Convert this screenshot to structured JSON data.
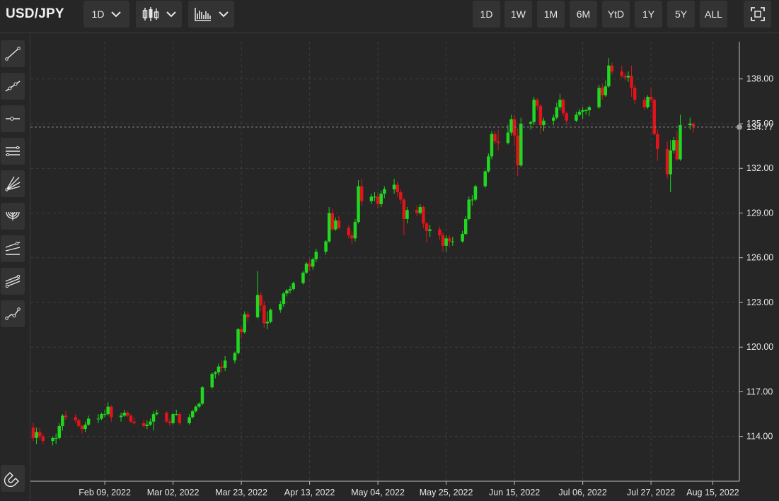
{
  "header": {
    "symbol": "USD/JPY",
    "interval_label": "1D",
    "chart_type_icon": "candlestick-icon",
    "indicator_icon": "bar-chart-icon",
    "ranges": [
      "1D",
      "1W",
      "1M",
      "6M",
      "YtD",
      "1Y",
      "5Y",
      "ALL"
    ],
    "fullscreen_icon": "fullscreen-icon"
  },
  "sidebar": {
    "tools": [
      "trend-line-icon",
      "extended-line-icon",
      "horizontal-ray-icon",
      "parallel-channel-icon",
      "fan-lines-icon",
      "arc-icon",
      "pitchfork-icon",
      "fibonacci-icon",
      "polyline-icon"
    ],
    "magnet_icon": "magnet-icon"
  },
  "colors": {
    "up": "#1fd81f",
    "down": "#e1141b",
    "background": "#262626",
    "grid": "#3d3d3d",
    "last_price_line": "#8c8c8c"
  },
  "chart_data": {
    "type": "candlestick",
    "title": "",
    "xlabel": "",
    "ylabel": "",
    "ylim": [
      111,
      140.5
    ],
    "y_ticks": [
      "114.00",
      "117.00",
      "120.00",
      "123.00",
      "126.00",
      "129.00",
      "132.00",
      "135.00",
      "138.00"
    ],
    "x_ticks": [
      {
        "date": "2022-02-09",
        "label": "Feb 09, 2022"
      },
      {
        "date": "2022-03-02",
        "label": "Mar 02, 2022"
      },
      {
        "date": "2022-03-23",
        "label": "Mar 23, 2022"
      },
      {
        "date": "2022-04-13",
        "label": "Apr 13, 2022"
      },
      {
        "date": "2022-05-04",
        "label": "May 04, 2022"
      },
      {
        "date": "2022-05-25",
        "label": "May 25, 2022"
      },
      {
        "date": "2022-06-15",
        "label": "Jun 15, 2022"
      },
      {
        "date": "2022-07-06",
        "label": "Jul 06, 2022"
      },
      {
        "date": "2022-07-27",
        "label": "Jul 27, 2022"
      },
      {
        "date": "2022-08-15",
        "label": "Aug 15, 2022"
      }
    ],
    "x_range": [
      "2022-01-18",
      "2022-08-21"
    ],
    "last_price": "134.77",
    "grid": true,
    "candles": [
      [
        "2022-01-18",
        114.6,
        114.9,
        113.7,
        113.9
      ],
      [
        "2022-01-19",
        113.9,
        114.6,
        113.5,
        114.3
      ],
      [
        "2022-01-20",
        114.3,
        114.6,
        113.8,
        114.0
      ],
      [
        "2022-01-21",
        114.0,
        114.2,
        113.5,
        113.7
      ],
      [
        "2022-01-24",
        113.7,
        114.0,
        113.4,
        113.9
      ],
      [
        "2022-01-25",
        113.9,
        114.2,
        113.5,
        113.9
      ],
      [
        "2022-01-26",
        113.9,
        114.9,
        113.8,
        114.7
      ],
      [
        "2022-01-27",
        114.7,
        115.5,
        114.4,
        115.4
      ],
      [
        "2022-01-28",
        115.4,
        115.7,
        115.1,
        115.3
      ],
      [
        "2022-01-31",
        115.3,
        115.5,
        114.9,
        115.1
      ],
      [
        "2022-02-01",
        115.1,
        115.2,
        114.6,
        114.7
      ],
      [
        "2022-02-02",
        114.7,
        114.8,
        114.2,
        114.5
      ],
      [
        "2022-02-03",
        114.5,
        115.0,
        114.3,
        114.8
      ],
      [
        "2022-02-04",
        114.8,
        115.4,
        114.7,
        115.2
      ],
      [
        "2022-02-07",
        115.2,
        115.5,
        114.9,
        115.2
      ],
      [
        "2022-02-08",
        115.2,
        115.6,
        115.1,
        115.5
      ],
      [
        "2022-02-09",
        115.5,
        115.8,
        115.3,
        115.5
      ],
      [
        "2022-02-10",
        115.5,
        116.3,
        115.4,
        116.0
      ],
      [
        "2022-02-11",
        116.0,
        116.1,
        115.0,
        115.3
      ],
      [
        "2022-02-14",
        115.3,
        115.6,
        115.0,
        115.4
      ],
      [
        "2022-02-15",
        115.4,
        115.8,
        115.3,
        115.6
      ],
      [
        "2022-02-16",
        115.6,
        115.7,
        115.3,
        115.4
      ],
      [
        "2022-02-17",
        115.4,
        115.5,
        114.9,
        115.0
      ],
      [
        "2022-02-18",
        115.0,
        115.3,
        114.8,
        114.9
      ],
      [
        "2022-02-21",
        114.9,
        115.1,
        114.6,
        114.7
      ],
      [
        "2022-02-22",
        114.7,
        115.1,
        114.5,
        114.8
      ],
      [
        "2022-02-23",
        114.8,
        115.2,
        114.7,
        115.0
      ],
      [
        "2022-02-24",
        115.0,
        115.7,
        114.4,
        115.5
      ],
      [
        "2022-02-25",
        115.5,
        115.8,
        115.4,
        115.6
      ],
      [
        "2022-02-28",
        115.6,
        115.7,
        114.9,
        115.0
      ],
      [
        "2022-03-01",
        115.0,
        115.2,
        114.7,
        114.9
      ],
      [
        "2022-03-02",
        114.9,
        115.6,
        114.8,
        115.5
      ],
      [
        "2022-03-03",
        115.5,
        115.8,
        115.4,
        115.5
      ],
      [
        "2022-03-04",
        115.5,
        115.6,
        114.8,
        114.9
      ],
      [
        "2022-03-07",
        114.9,
        115.5,
        114.8,
        115.3
      ],
      [
        "2022-03-08",
        115.3,
        115.8,
        115.2,
        115.7
      ],
      [
        "2022-03-09",
        115.7,
        116.1,
        115.6,
        116.0
      ],
      [
        "2022-03-10",
        116.0,
        116.3,
        115.9,
        116.2
      ],
      [
        "2022-03-11",
        116.2,
        117.4,
        116.1,
        117.3
      ],
      [
        "2022-03-14",
        117.3,
        118.3,
        117.2,
        118.2
      ],
      [
        "2022-03-15",
        118.2,
        118.4,
        117.9,
        118.3
      ],
      [
        "2022-03-16",
        118.3,
        118.9,
        118.1,
        118.7
      ],
      [
        "2022-03-17",
        118.7,
        119.1,
        118.3,
        118.6
      ],
      [
        "2022-03-18",
        118.6,
        119.4,
        118.4,
        119.1
      ],
      [
        "2022-03-21",
        119.1,
        119.7,
        118.9,
        119.6
      ],
      [
        "2022-03-22",
        119.6,
        121.3,
        119.5,
        121.2
      ],
      [
        "2022-03-23",
        121.2,
        121.4,
        120.6,
        121.0
      ],
      [
        "2022-03-24",
        121.0,
        122.4,
        120.9,
        122.2
      ],
      [
        "2022-03-25",
        122.2,
        122.4,
        121.7,
        122.0
      ],
      [
        "2022-03-28",
        122.0,
        125.1,
        121.9,
        123.5
      ],
      [
        "2022-03-29",
        123.5,
        123.7,
        122.4,
        122.8
      ],
      [
        "2022-03-30",
        122.8,
        123.1,
        121.3,
        121.6
      ],
      [
        "2022-03-31",
        121.6,
        122.4,
        121.2,
        121.7
      ],
      [
        "2022-04-01",
        121.7,
        122.6,
        121.6,
        122.5
      ],
      [
        "2022-04-04",
        122.5,
        123.1,
        122.3,
        122.9
      ],
      [
        "2022-04-05",
        122.9,
        123.7,
        122.7,
        123.6
      ],
      [
        "2022-04-06",
        123.6,
        123.9,
        123.4,
        123.8
      ],
      [
        "2022-04-07",
        123.8,
        124.1,
        123.6,
        123.9
      ],
      [
        "2022-04-08",
        123.9,
        124.4,
        123.8,
        124.3
      ],
      [
        "2022-04-11",
        124.3,
        125.1,
        124.2,
        125.0
      ],
      [
        "2022-04-12",
        125.0,
        125.7,
        124.9,
        125.6
      ],
      [
        "2022-04-13",
        125.6,
        125.9,
        125.1,
        125.4
      ],
      [
        "2022-04-14",
        125.4,
        126.0,
        125.2,
        125.9
      ],
      [
        "2022-04-15",
        125.9,
        126.6,
        125.7,
        126.4
      ],
      [
        "2022-04-18",
        126.4,
        127.2,
        126.2,
        127.1
      ],
      [
        "2022-04-19",
        127.1,
        129.4,
        127.0,
        129.0
      ],
      [
        "2022-04-20",
        129.0,
        129.3,
        127.8,
        127.9
      ],
      [
        "2022-04-21",
        127.9,
        128.7,
        127.8,
        128.5
      ],
      [
        "2022-04-22",
        128.5,
        128.8,
        127.9,
        128.0
      ],
      [
        "2022-04-25",
        128.0,
        128.2,
        127.3,
        127.5
      ],
      [
        "2022-04-26",
        127.5,
        127.8,
        126.9,
        127.3
      ],
      [
        "2022-04-27",
        127.3,
        128.6,
        127.1,
        128.4
      ],
      [
        "2022-04-28",
        128.4,
        131.2,
        128.3,
        130.8
      ],
      [
        "2022-04-29",
        130.8,
        131.3,
        129.5,
        129.8
      ],
      [
        "2022-05-02",
        129.8,
        130.3,
        129.6,
        130.1
      ],
      [
        "2022-05-03",
        130.1,
        130.4,
        129.8,
        130.1
      ],
      [
        "2022-05-04",
        130.1,
        130.4,
        129.3,
        129.6
      ],
      [
        "2022-05-05",
        129.6,
        130.5,
        129.4,
        130.3
      ],
      [
        "2022-05-06",
        130.3,
        130.8,
        130.0,
        130.6
      ],
      [
        "2022-05-09",
        130.6,
        131.3,
        130.3,
        130.9
      ],
      [
        "2022-05-10",
        130.9,
        131.1,
        130.1,
        130.4
      ],
      [
        "2022-05-11",
        130.4,
        130.6,
        129.6,
        129.9
      ],
      [
        "2022-05-12",
        129.9,
        130.0,
        127.5,
        128.6
      ],
      [
        "2022-05-13",
        128.6,
        129.4,
        128.3,
        129.2
      ],
      [
        "2022-05-16",
        129.2,
        129.5,
        128.8,
        129.0
      ],
      [
        "2022-05-17",
        129.0,
        129.6,
        128.9,
        129.4
      ],
      [
        "2022-05-18",
        129.4,
        129.5,
        128.0,
        128.3
      ],
      [
        "2022-05-19",
        128.3,
        128.4,
        127.0,
        127.8
      ],
      [
        "2022-05-20",
        127.8,
        128.2,
        127.4,
        127.9
      ],
      [
        "2022-05-23",
        127.9,
        128.1,
        127.2,
        127.5
      ],
      [
        "2022-05-24",
        127.5,
        127.7,
        126.4,
        126.8
      ],
      [
        "2022-05-25",
        126.8,
        127.5,
        126.4,
        127.3
      ],
      [
        "2022-05-26",
        127.3,
        127.5,
        126.7,
        127.1
      ],
      [
        "2022-05-27",
        127.1,
        127.4,
        126.8,
        127.1
      ],
      [
        "2022-05-30",
        127.1,
        127.8,
        127.0,
        127.6
      ],
      [
        "2022-05-31",
        127.6,
        128.8,
        127.5,
        128.6
      ],
      [
        "2022-06-01",
        128.6,
        130.1,
        128.5,
        129.9
      ],
      [
        "2022-06-02",
        129.9,
        130.2,
        129.5,
        129.9
      ],
      [
        "2022-06-03",
        129.9,
        130.9,
        129.8,
        130.8
      ],
      [
        "2022-06-06",
        130.8,
        131.9,
        130.7,
        131.8
      ],
      [
        "2022-06-07",
        131.8,
        133.0,
        131.7,
        132.8
      ],
      [
        "2022-06-08",
        132.8,
        134.5,
        132.6,
        134.3
      ],
      [
        "2022-06-09",
        134.3,
        134.5,
        133.6,
        133.8
      ],
      [
        "2022-06-10",
        133.8,
        134.6,
        133.2,
        133.7
      ],
      [
        "2022-06-13",
        133.7,
        134.9,
        133.6,
        134.4
      ],
      [
        "2022-06-14",
        134.4,
        135.6,
        134.2,
        135.3
      ],
      [
        "2022-06-15",
        135.3,
        135.6,
        133.5,
        134.2
      ],
      [
        "2022-06-16",
        134.2,
        134.7,
        131.5,
        132.2
      ],
      [
        "2022-06-17",
        132.2,
        135.4,
        132.1,
        135.0
      ],
      [
        "2022-06-20",
        135.0,
        135.2,
        134.6,
        135.1
      ],
      [
        "2022-06-21",
        135.1,
        136.8,
        134.9,
        136.6
      ],
      [
        "2022-06-22",
        136.6,
        136.7,
        135.9,
        136.2
      ],
      [
        "2022-06-23",
        136.2,
        136.3,
        134.3,
        134.9
      ],
      [
        "2022-06-24",
        134.9,
        135.4,
        134.5,
        135.2
      ],
      [
        "2022-06-27",
        135.2,
        135.6,
        134.9,
        135.4
      ],
      [
        "2022-06-28",
        135.4,
        136.4,
        135.3,
        136.1
      ],
      [
        "2022-06-29",
        136.1,
        137.0,
        135.9,
        136.6
      ],
      [
        "2022-06-30",
        136.6,
        136.7,
        135.5,
        135.7
      ],
      [
        "2022-07-01",
        135.7,
        135.8,
        134.9,
        135.2
      ],
      [
        "2022-07-04",
        135.2,
        135.8,
        135.1,
        135.6
      ],
      [
        "2022-07-05",
        135.6,
        136.0,
        135.5,
        135.8
      ],
      [
        "2022-07-06",
        135.8,
        136.1,
        135.3,
        135.9
      ],
      [
        "2022-07-07",
        135.9,
        136.0,
        135.6,
        135.9
      ],
      [
        "2022-07-08",
        135.9,
        136.2,
        135.5,
        136.1
      ],
      [
        "2022-07-11",
        136.1,
        137.6,
        136.0,
        137.4
      ],
      [
        "2022-07-12",
        137.4,
        137.7,
        136.6,
        136.9
      ],
      [
        "2022-07-13",
        136.9,
        137.9,
        136.8,
        137.5
      ],
      [
        "2022-07-14",
        137.5,
        139.4,
        137.4,
        138.9
      ],
      [
        "2022-07-15",
        138.9,
        139.1,
        138.3,
        138.5
      ],
      [
        "2022-07-18",
        138.5,
        138.9,
        138.1,
        138.2
      ],
      [
        "2022-07-19",
        138.2,
        138.4,
        137.9,
        138.1
      ],
      [
        "2022-07-20",
        138.1,
        138.5,
        137.8,
        138.2
      ],
      [
        "2022-07-21",
        138.2,
        138.9,
        136.8,
        137.4
      ],
      [
        "2022-07-22",
        137.4,
        137.6,
        136.3,
        136.6
      ],
      [
        "2022-07-25",
        136.6,
        136.8,
        135.9,
        136.1
      ],
      [
        "2022-07-26",
        136.1,
        136.9,
        136.0,
        136.8
      ],
      [
        "2022-07-27",
        136.8,
        137.4,
        136.4,
        136.6
      ],
      [
        "2022-07-28",
        136.6,
        136.7,
        134.2,
        134.3
      ],
      [
        "2022-07-29",
        134.3,
        134.6,
        132.5,
        133.3
      ],
      [
        "2022-08-01",
        133.3,
        133.8,
        131.3,
        131.6
      ],
      [
        "2022-08-02",
        131.6,
        133.9,
        130.4,
        133.2
      ],
      [
        "2022-08-03",
        133.2,
        134.1,
        133.0,
        133.9
      ],
      [
        "2022-08-04",
        133.9,
        134.5,
        132.5,
        132.6
      ],
      [
        "2022-08-05",
        132.6,
        135.6,
        132.5,
        134.9
      ],
      [
        "2022-08-08",
        134.9,
        135.4,
        134.6,
        135.0
      ],
      [
        "2022-08-09",
        135.0,
        135.1,
        134.4,
        134.8
      ]
    ]
  }
}
